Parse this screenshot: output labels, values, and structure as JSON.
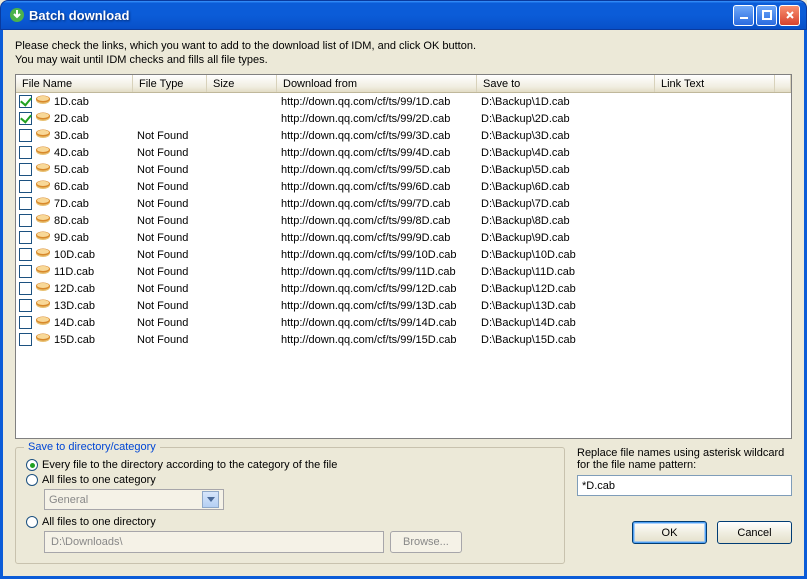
{
  "window": {
    "title": "Batch download"
  },
  "instructions": {
    "line1": "Please check the links, which you want to add to the download list of IDM, and click OK button.",
    "line2": "You may wait until IDM checks and fills all file types."
  },
  "columns": {
    "file_name": "File Name",
    "file_type": "File Type",
    "size": "Size",
    "download_from": "Download from",
    "save_to": "Save to",
    "link_text": "Link Text"
  },
  "rows": [
    {
      "checked": true,
      "name": "1D.cab",
      "type": "",
      "size": "",
      "from": "http://down.qq.com/cf/ts/99/1D.cab",
      "to": "D:\\Backup\\1D.cab",
      "link": ""
    },
    {
      "checked": true,
      "name": "2D.cab",
      "type": "",
      "size": "",
      "from": "http://down.qq.com/cf/ts/99/2D.cab",
      "to": "D:\\Backup\\2D.cab",
      "link": ""
    },
    {
      "checked": false,
      "name": "3D.cab",
      "type": "Not Found",
      "size": "",
      "from": "http://down.qq.com/cf/ts/99/3D.cab",
      "to": "D:\\Backup\\3D.cab",
      "link": ""
    },
    {
      "checked": false,
      "name": "4D.cab",
      "type": "Not Found",
      "size": "",
      "from": "http://down.qq.com/cf/ts/99/4D.cab",
      "to": "D:\\Backup\\4D.cab",
      "link": ""
    },
    {
      "checked": false,
      "name": "5D.cab",
      "type": "Not Found",
      "size": "",
      "from": "http://down.qq.com/cf/ts/99/5D.cab",
      "to": "D:\\Backup\\5D.cab",
      "link": ""
    },
    {
      "checked": false,
      "name": "6D.cab",
      "type": "Not Found",
      "size": "",
      "from": "http://down.qq.com/cf/ts/99/6D.cab",
      "to": "D:\\Backup\\6D.cab",
      "link": ""
    },
    {
      "checked": false,
      "name": "7D.cab",
      "type": "Not Found",
      "size": "",
      "from": "http://down.qq.com/cf/ts/99/7D.cab",
      "to": "D:\\Backup\\7D.cab",
      "link": ""
    },
    {
      "checked": false,
      "name": "8D.cab",
      "type": "Not Found",
      "size": "",
      "from": "http://down.qq.com/cf/ts/99/8D.cab",
      "to": "D:\\Backup\\8D.cab",
      "link": ""
    },
    {
      "checked": false,
      "name": "9D.cab",
      "type": "Not Found",
      "size": "",
      "from": "http://down.qq.com/cf/ts/99/9D.cab",
      "to": "D:\\Backup\\9D.cab",
      "link": ""
    },
    {
      "checked": false,
      "name": "10D.cab",
      "type": "Not Found",
      "size": "",
      "from": "http://down.qq.com/cf/ts/99/10D.cab",
      "to": "D:\\Backup\\10D.cab",
      "link": ""
    },
    {
      "checked": false,
      "name": "11D.cab",
      "type": "Not Found",
      "size": "",
      "from": "http://down.qq.com/cf/ts/99/11D.cab",
      "to": "D:\\Backup\\11D.cab",
      "link": ""
    },
    {
      "checked": false,
      "name": "12D.cab",
      "type": "Not Found",
      "size": "",
      "from": "http://down.qq.com/cf/ts/99/12D.cab",
      "to": "D:\\Backup\\12D.cab",
      "link": ""
    },
    {
      "checked": false,
      "name": "13D.cab",
      "type": "Not Found",
      "size": "",
      "from": "http://down.qq.com/cf/ts/99/13D.cab",
      "to": "D:\\Backup\\13D.cab",
      "link": ""
    },
    {
      "checked": false,
      "name": "14D.cab",
      "type": "Not Found",
      "size": "",
      "from": "http://down.qq.com/cf/ts/99/14D.cab",
      "to": "D:\\Backup\\14D.cab",
      "link": ""
    },
    {
      "checked": false,
      "name": "15D.cab",
      "type": "Not Found",
      "size": "",
      "from": "http://down.qq.com/cf/ts/99/15D.cab",
      "to": "D:\\Backup\\15D.cab",
      "link": ""
    }
  ],
  "save_group": {
    "legend": "Save to directory/category",
    "opt_category": "Every file to the directory according to the category of the file",
    "opt_one_category": "All files to one category",
    "category_value": "General",
    "opt_one_directory": "All files to one directory",
    "directory_value": "D:\\Downloads\\",
    "browse_label": "Browse..."
  },
  "pattern": {
    "label": "Replace file names using asterisk wildcard for the file name pattern:",
    "value": "*D.cab"
  },
  "buttons": {
    "ok": "OK",
    "cancel": "Cancel"
  }
}
